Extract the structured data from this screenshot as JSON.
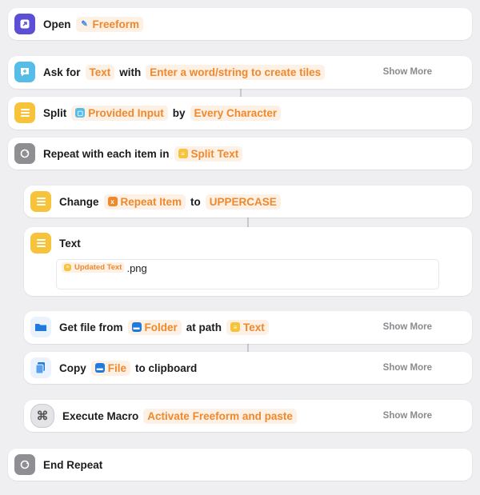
{
  "actions": {
    "open": {
      "label": "Open",
      "app": "Freeform"
    },
    "ask": {
      "label": "Ask for",
      "type": "Text",
      "with": "with",
      "prompt": "Enter a word/string to create tiles",
      "more": "Show More"
    },
    "split": {
      "label": "Split",
      "input": "Provided Input",
      "by": "by",
      "separator": "Every Character"
    },
    "repeat": {
      "label": "Repeat with each item in",
      "source": "Split Text"
    },
    "change": {
      "label": "Change",
      "item": "Repeat Item",
      "to": "to",
      "case": "UPPERCASE"
    },
    "text": {
      "label": "Text",
      "var": "Updated Text",
      "suffix": ".png"
    },
    "getfile": {
      "label": "Get file from",
      "folder": "Folder",
      "at": "at path",
      "path": "Text",
      "more": "Show More"
    },
    "copy": {
      "label": "Copy",
      "file": "File",
      "to": "to clipboard",
      "more": "Show More"
    },
    "macro": {
      "label": "Execute Macro",
      "name": "Activate Freeform and paste",
      "more": "Show More"
    },
    "end": {
      "label": "End Repeat"
    }
  },
  "colors": {
    "accent": "#f0882c",
    "token_bg": "#fdf0e4",
    "yellow": "#f7c33a",
    "gray": "#8e8e93",
    "purple": "#5d4ed6",
    "teal": "#55bde8",
    "blue": "#1f7ae0"
  },
  "icons": [
    "open-app-icon",
    "ask-input-icon",
    "text-lines-icon",
    "repeat-icon",
    "variable-icon",
    "folder-icon",
    "copy-file-icon",
    "macro-icon"
  ]
}
